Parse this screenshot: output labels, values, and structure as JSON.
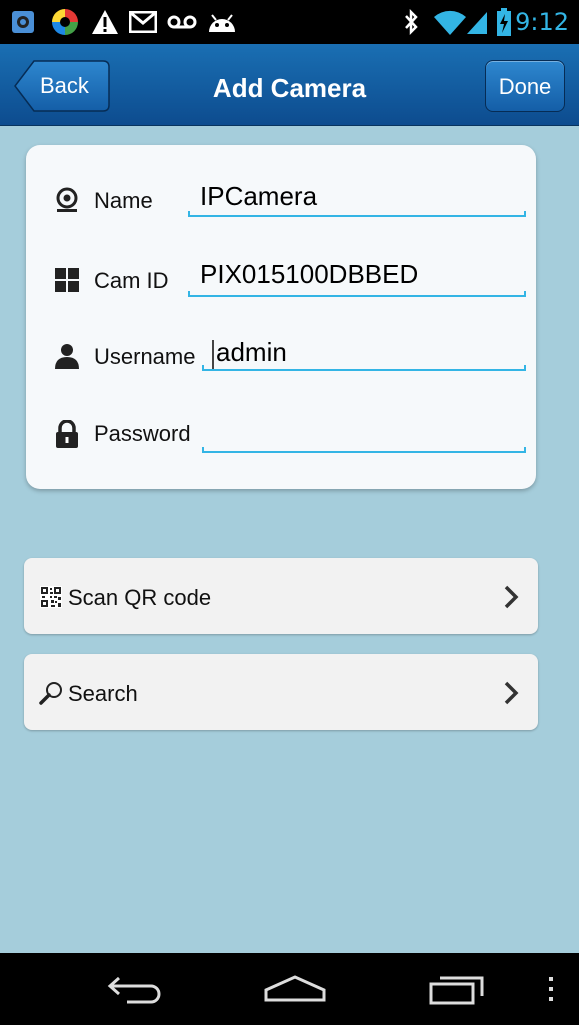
{
  "status_bar": {
    "time": "9:12",
    "left_icons": [
      "photo-icon",
      "sync-icon",
      "warning-icon",
      "gmail-icon",
      "voicemail-icon",
      "android-icon"
    ],
    "right_icons": [
      "bluetooth-icon",
      "wifi-icon",
      "signal-icon",
      "battery-charging-icon"
    ],
    "accent": "#33b5e5"
  },
  "header": {
    "back_label": "Back",
    "title": "Add Camera",
    "done_label": "Done",
    "color": "#1a6fb3"
  },
  "form": {
    "name": {
      "label": "Name",
      "value": "IPCamera",
      "icon": "webcam-icon"
    },
    "cam_id": {
      "label": "Cam ID",
      "value": "PIX015100DBBED",
      "icon": "grid-icon"
    },
    "username": {
      "label": "Username",
      "value": "admin",
      "icon": "user-icon"
    },
    "password": {
      "label": "Password",
      "value": "",
      "icon": "lock-icon"
    }
  },
  "actions": {
    "scan_qr": {
      "label": "Scan QR code",
      "icon": "qr-code-icon"
    },
    "search": {
      "label": "Search",
      "icon": "magnifier-icon"
    }
  },
  "nav_bar": {
    "items": [
      "back-nav-icon",
      "home-nav-icon",
      "recent-apps-icon",
      "menu-overflow-icon"
    ]
  },
  "background": "#a5cddb"
}
